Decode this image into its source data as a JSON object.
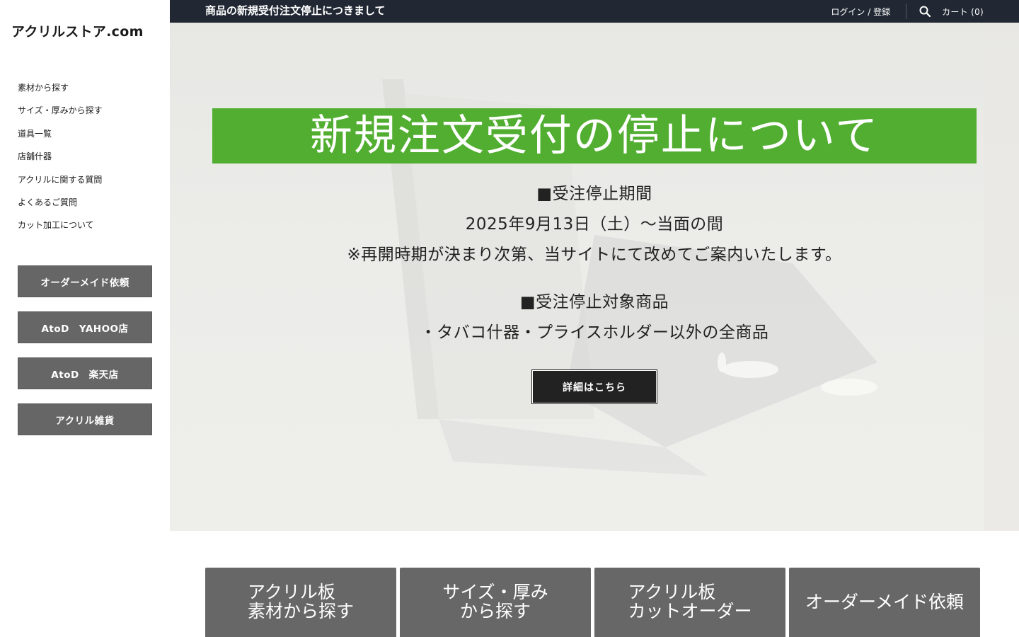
{
  "sidebar": {
    "logo": "アクリルストア.com",
    "nav": [
      "素材から探す",
      "サイズ・厚みから探す",
      "道具一覧",
      "店舗什器",
      "アクリルに関する質問",
      "よくあるご質問",
      "カット加工について"
    ],
    "buttons": [
      "オーダーメイド依頼",
      "AtoD　YAHOO店",
      "AtoD　楽天店",
      "アクリル雑貨"
    ]
  },
  "topbar": {
    "announcement": "商品の新規受付注文停止につきまして",
    "login": "ログイン / 登録",
    "cart": "カート (0)",
    "search_icon": "search-icon"
  },
  "hero": {
    "banner": "新規注文受付の停止について",
    "lines": [
      "■受注停止期間",
      "2025年9月13日（土）～当面の間",
      "※再開時期が決まり次第、当サイトにて改めてご案内いたします。",
      "■受注停止対象商品",
      "・タバコ什器・プライスホルダー以外の全商品"
    ],
    "button": "詳細はこちら",
    "banner_color": "#51ae31"
  },
  "tiles": [
    {
      "line1": "アクリル板",
      "line2": "素材から探す"
    },
    {
      "line1": "サイズ・厚み",
      "line2": "から探す"
    },
    {
      "line1": "アクリル板",
      "line2": "カットオーダー"
    },
    {
      "line1": "オーダーメイド依頼",
      "line2": ""
    }
  ]
}
